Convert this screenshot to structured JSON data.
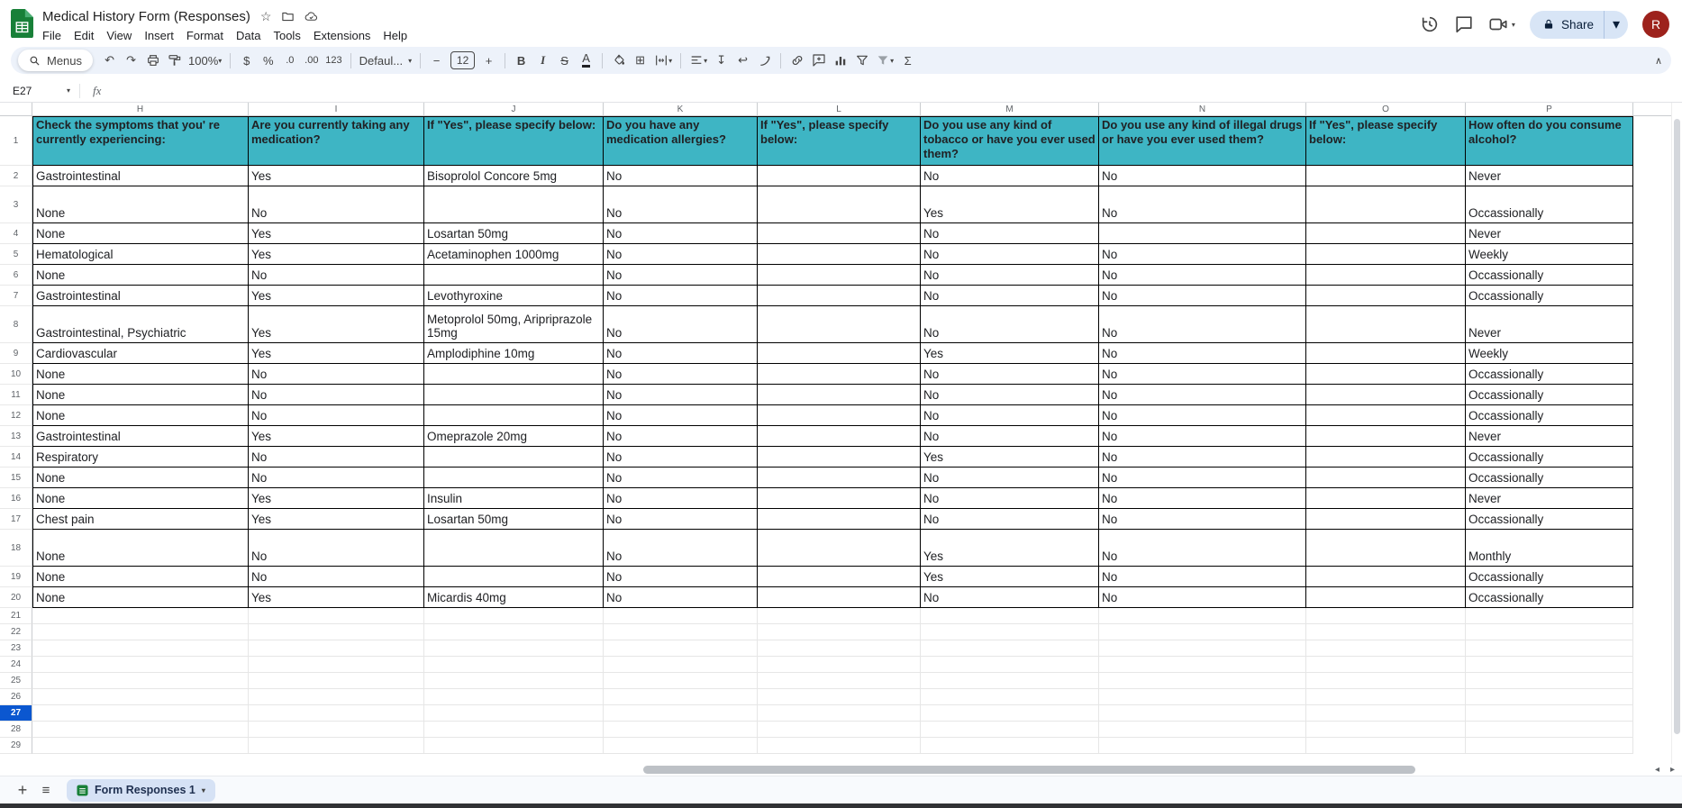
{
  "topbar": {
    "title": "Medical History Form (Responses)",
    "menus": [
      "File",
      "Edit",
      "View",
      "Insert",
      "Format",
      "Data",
      "Tools",
      "Extensions",
      "Help"
    ],
    "share_label": "Share",
    "avatar_letter": "R"
  },
  "toolbar": {
    "menus_label": "Menus",
    "zoom": "100%",
    "currency": "$",
    "percent": "%",
    "decimal_decrease": ".0",
    "decimal_increase": ".00",
    "number_format": "123",
    "font_family": "Defaul...",
    "font_size": "12",
    "minus": "−",
    "plus": "+",
    "bold": "B",
    "italic": "I",
    "strikethrough": "S",
    "text_color": "A",
    "functions": "Σ"
  },
  "formula_bar": {
    "name_box": "E27",
    "fx_label": "fx"
  },
  "grid": {
    "column_letters": [
      "H",
      "I",
      "J",
      "K",
      "L",
      "M",
      "N",
      "O",
      "P"
    ],
    "header_bg": "#3eb5c4",
    "header_row": [
      "Check the symptoms that you' re currently experiencing:",
      "Are you currently taking any medication?",
      "If \"Yes\", please specify below:",
      "Do you have any medication allergies?",
      "If \"Yes\", please specify below:",
      "Do you use any kind of tobacco or have you ever used them?",
      "Do you use any kind of illegal drugs or have you ever used them?",
      "If \"Yes\", please specify below:",
      "How often do you consume alcohol?"
    ],
    "data_rows": [
      [
        "Gastrointestinal",
        "Yes",
        "Bisoprolol Concore 5mg",
        "No",
        "",
        "No",
        "No",
        "",
        "Never"
      ],
      [
        "None",
        "No",
        "",
        "No",
        "",
        "Yes",
        "No",
        "",
        "Occassionally"
      ],
      [
        "None",
        "Yes",
        "Losartan 50mg",
        "No",
        "",
        "No",
        "",
        "",
        "Never"
      ],
      [
        "Hematological",
        "Yes",
        "Acetaminophen 1000mg",
        "No",
        "",
        "No",
        "No",
        "",
        "Weekly"
      ],
      [
        "None",
        "No",
        "",
        "No",
        "",
        "No",
        "No",
        "",
        "Occassionally"
      ],
      [
        "Gastrointestinal",
        "Yes",
        "Levothyroxine",
        "No",
        "",
        "No",
        "No",
        "",
        "Occassionally"
      ],
      [
        "Gastrointestinal, Psychiatric",
        "Yes",
        "Metoprolol 50mg, Aripriprazole 15mg",
        "No",
        "",
        "No",
        "No",
        "",
        "Never"
      ],
      [
        "Cardiovascular",
        "Yes",
        "Amplodiphine 10mg",
        "No",
        "",
        "Yes",
        "No",
        "",
        "Weekly"
      ],
      [
        "None",
        "No",
        "",
        "No",
        "",
        "No",
        "No",
        "",
        "Occassionally"
      ],
      [
        "None",
        "No",
        "",
        "No",
        "",
        "No",
        "No",
        "",
        "Occassionally"
      ],
      [
        "None",
        "No",
        "",
        "No",
        "",
        "No",
        "No",
        "",
        "Occassionally"
      ],
      [
        "Gastrointestinal",
        "Yes",
        "Omeprazole 20mg",
        "No",
        "",
        "No",
        "No",
        "",
        "Never"
      ],
      [
        "Respiratory",
        "No",
        "",
        "No",
        "",
        "Yes",
        "No",
        "",
        "Occassionally"
      ],
      [
        "None",
        "No",
        "",
        "No",
        "",
        "No",
        "No",
        "",
        "Occassionally"
      ],
      [
        "None",
        "Yes",
        "Insulin",
        "No",
        "",
        "No",
        "No",
        "",
        "Never"
      ],
      [
        "Chest pain",
        "Yes",
        "Losartan 50mg",
        "No",
        "",
        "No",
        "No",
        "",
        "Occassionally"
      ],
      [
        "None",
        "No",
        "",
        "No",
        "",
        "Yes",
        "No",
        "",
        "Monthly"
      ],
      [
        "None",
        "No",
        "",
        "No",
        "",
        "Yes",
        "No",
        "",
        "Occassionally"
      ],
      [
        "None",
        "Yes",
        "Micardis 40mg",
        "No",
        "",
        "No",
        "No",
        "",
        "Occassionally"
      ]
    ],
    "first_data_row_number": 2,
    "empty_rows_from": 21,
    "last_row_number": 29,
    "selected_row_number": 27
  },
  "sheet_tabs": {
    "active_tab": "Form Responses 1"
  }
}
